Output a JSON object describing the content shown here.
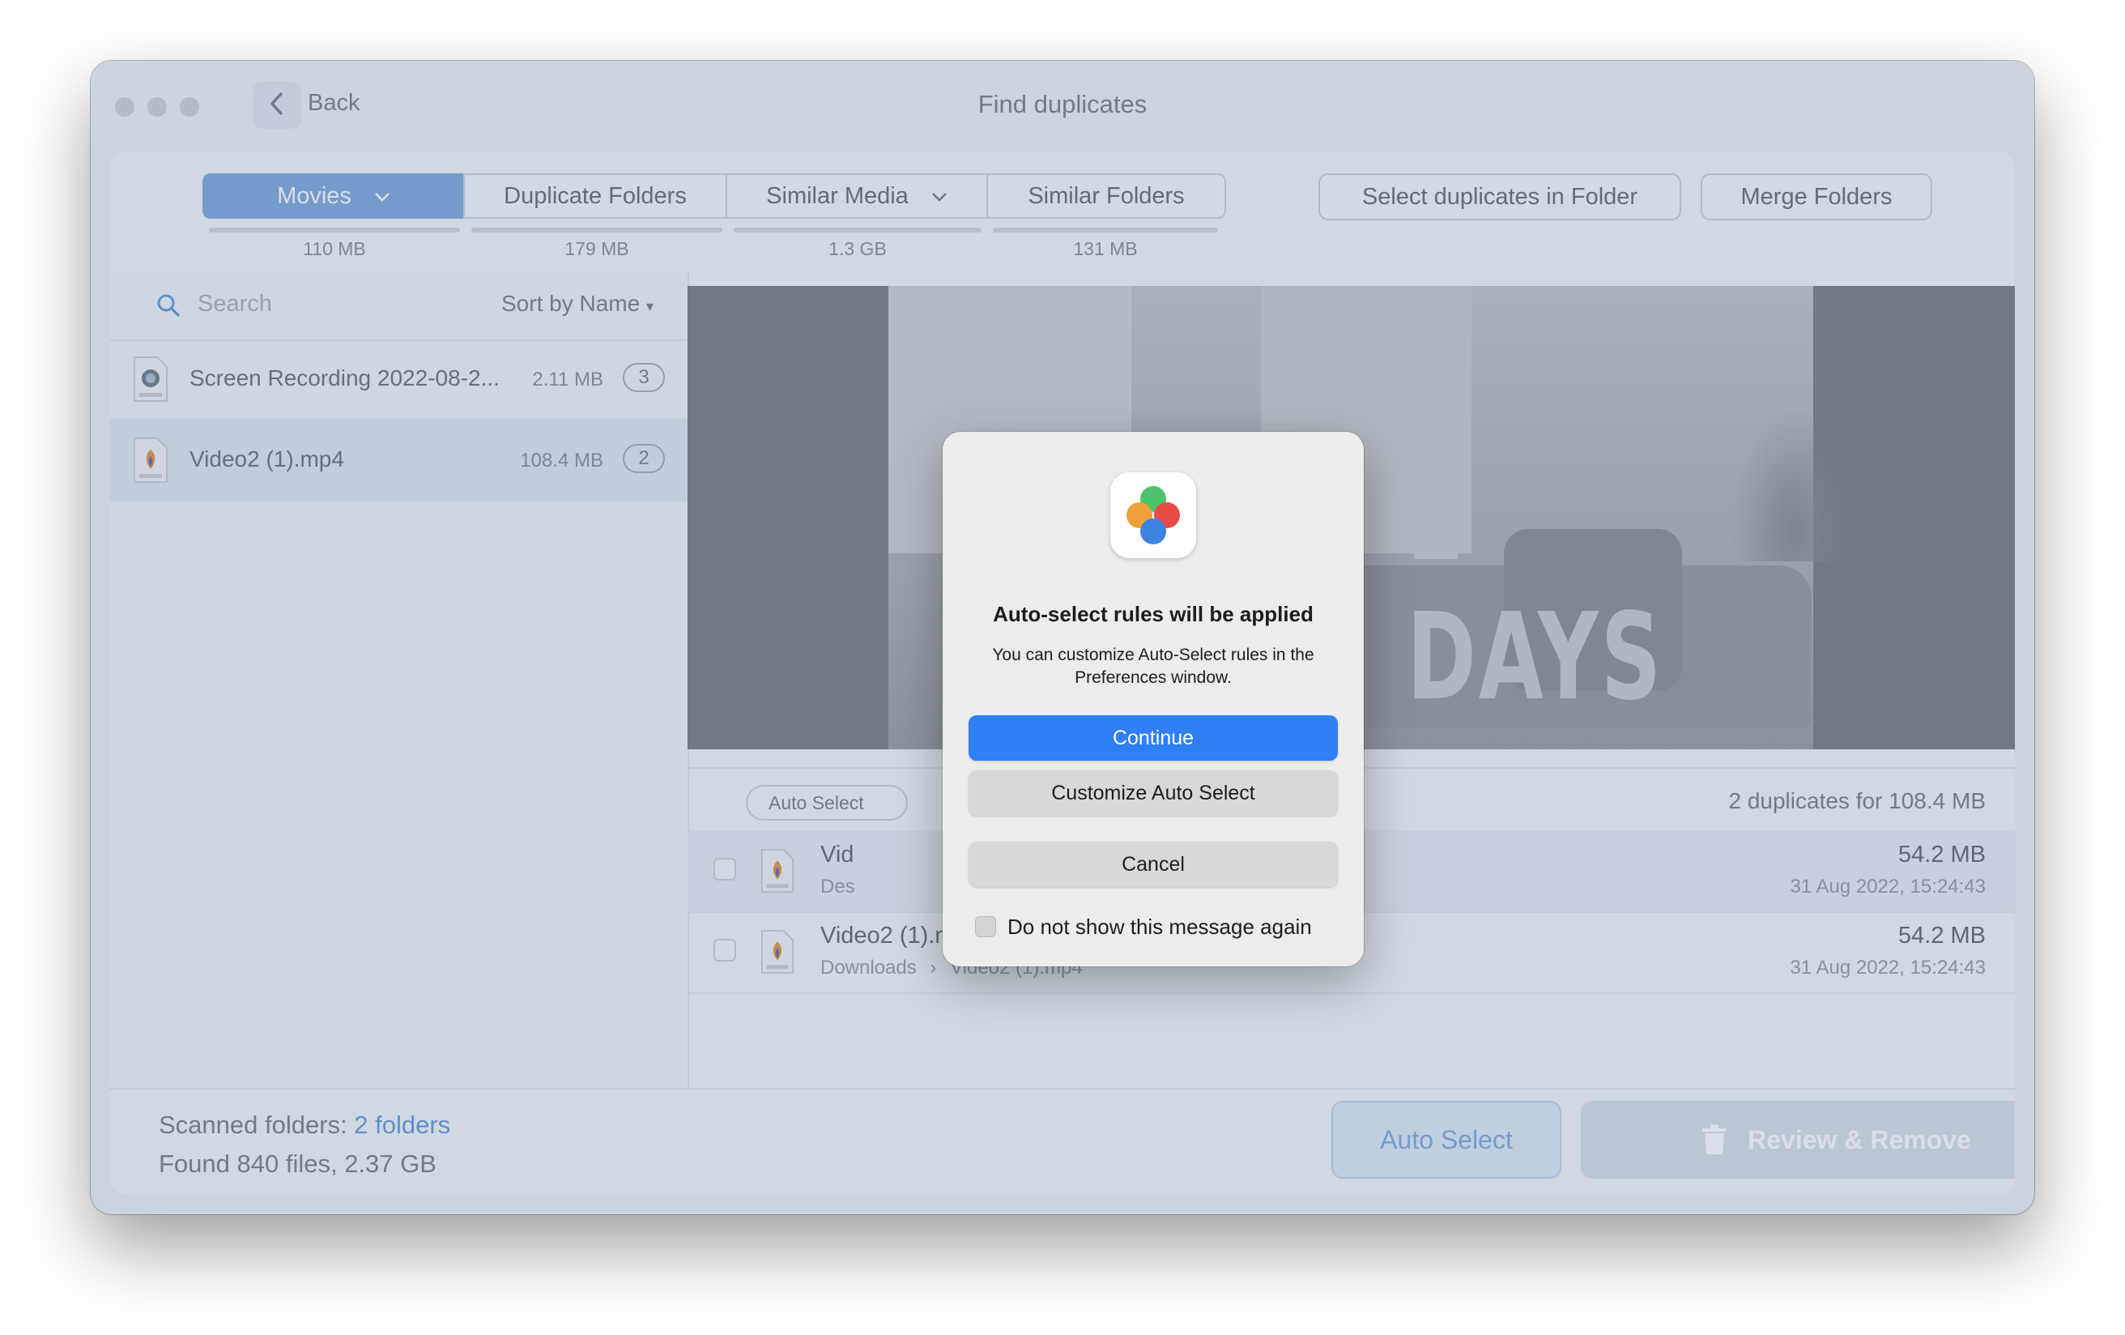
{
  "window": {
    "title": "Find duplicates",
    "back_label": "Back"
  },
  "tabs": [
    {
      "label": "Movies",
      "size": "110 MB",
      "active": true,
      "has_dropdown": true
    },
    {
      "label": "Duplicate Folders",
      "size": "179 MB",
      "active": false,
      "has_dropdown": false
    },
    {
      "label": "Similar Media",
      "size": "1.3 GB",
      "active": false,
      "has_dropdown": true
    },
    {
      "label": "Similar Folders",
      "size": "131 MB",
      "active": false,
      "has_dropdown": false
    }
  ],
  "toolbar": {
    "select_in_folder_label": "Select duplicates in Folder",
    "merge_folders_label": "Merge Folders"
  },
  "sidebar": {
    "search_placeholder": "Search",
    "sort_label": "Sort by Name",
    "files": [
      {
        "name": "Screen Recording 2022-08-2...",
        "size": "2.11 MB",
        "count": "3",
        "icon": "mov-file-icon"
      },
      {
        "name": "Video2 (1).mp4",
        "size": "108.4 MB",
        "count": "2",
        "icon": "mp4-file-icon",
        "selected": true
      }
    ]
  },
  "preview": {
    "overlay_text": "E DAYS"
  },
  "results": {
    "auto_select_pill": "Auto Select",
    "summary": "2 duplicates for 108.4 MB",
    "rows": [
      {
        "name": "Video2 (1).mp4",
        "name_visible": "Vid",
        "path_visible": "Des",
        "size": "54.2 MB",
        "date": "31 Aug 2022, 15:24:43",
        "selected": true
      },
      {
        "name": "Video2 (1).mp4",
        "path_folder": "Downloads",
        "path_sep": "›",
        "path_file": "Video2 (1).mp4",
        "size": "54.2 MB",
        "date": "31 Aug 2022, 15:24:43",
        "selected": false
      }
    ]
  },
  "footer": {
    "scanned_label": "Scanned folders:",
    "scanned_link": "2 folders",
    "found_text": "Found 840 files, 2.37 GB",
    "auto_select_label": "Auto Select",
    "review_remove_label": "Review & Remove"
  },
  "dialog": {
    "title": "Auto-select rules will be applied",
    "message": "You can customize Auto-Select rules in the Preferences window.",
    "continue_label": "Continue",
    "customize_label": "Customize Auto Select",
    "cancel_label": "Cancel",
    "dont_show_label": "Do not show this message again"
  },
  "colors": {
    "accent": "#2f7ff5",
    "active_tab": "#6f9ed6",
    "link": "#4f8fd8",
    "icon_green": "#4cc26a",
    "icon_orange": "#f0a03a",
    "icon_red": "#e84a45",
    "icon_blue": "#3e84e0"
  }
}
